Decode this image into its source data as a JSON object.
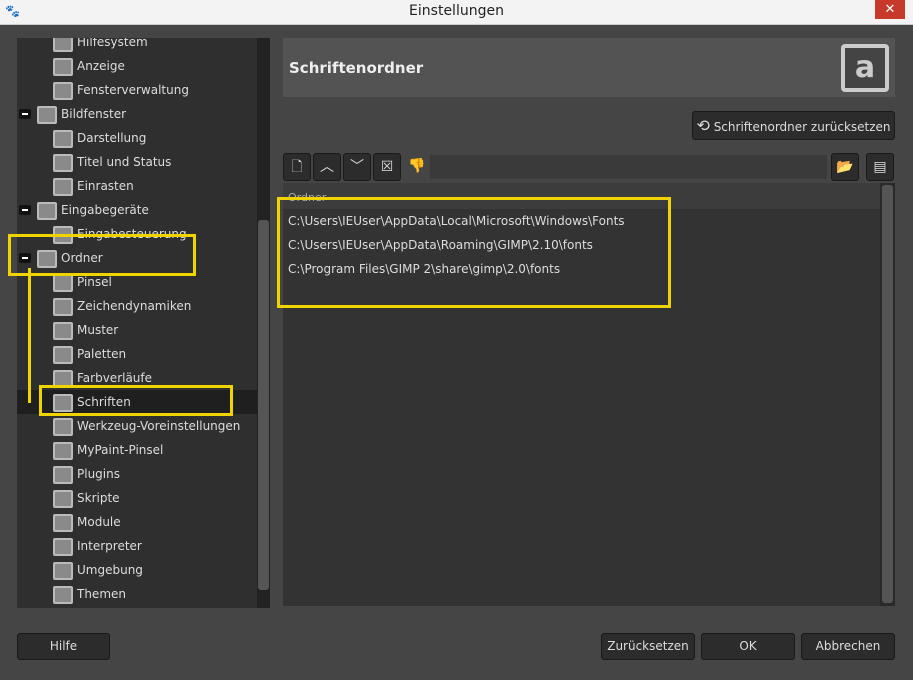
{
  "window": {
    "title": "Einstellungen",
    "close": "✕"
  },
  "tree": [
    {
      "label": "Hilfesystem",
      "level": 1
    },
    {
      "label": "Anzeige",
      "level": 1
    },
    {
      "label": "Fensterverwaltung",
      "level": 1
    },
    {
      "label": "Bildfenster",
      "level": 0
    },
    {
      "label": "Darstellung",
      "level": 1
    },
    {
      "label": "Titel und Status",
      "level": 1
    },
    {
      "label": "Einrasten",
      "level": 1
    },
    {
      "label": "Eingabegeräte",
      "level": 0
    },
    {
      "label": "Eingabesteuerung",
      "level": 1
    },
    {
      "label": "Ordner",
      "level": 0
    },
    {
      "label": "Pinsel",
      "level": 1
    },
    {
      "label": "Zeichendynamiken",
      "level": 1
    },
    {
      "label": "Muster",
      "level": 1
    },
    {
      "label": "Paletten",
      "level": 1
    },
    {
      "label": "Farbverläufe",
      "level": 1
    },
    {
      "label": "Schriften",
      "level": 1,
      "selected": true
    },
    {
      "label": "Werkzeug-Voreinstellungen",
      "level": 1
    },
    {
      "label": "MyPaint-Pinsel",
      "level": 1
    },
    {
      "label": "Plugins",
      "level": 1
    },
    {
      "label": "Skripte",
      "level": 1
    },
    {
      "label": "Module",
      "level": 1
    },
    {
      "label": "Interpreter",
      "level": 1
    },
    {
      "label": "Umgebung",
      "level": 1
    },
    {
      "label": "Themen",
      "level": 1
    }
  ],
  "panel": {
    "title": "Schriftenordner",
    "reset_button": "Schriftenordner zurücksetzen",
    "column_header": "Ordner",
    "folders": [
      "C:\\Users\\IEUser\\AppData\\Local\\Microsoft\\Windows\\Fonts",
      "C:\\Users\\IEUser\\AppData\\Roaming\\GIMP\\2.10\\fonts",
      "C:\\Program Files\\GIMP 2\\share\\gimp\\2.0\\fonts"
    ]
  },
  "footer": {
    "help": "Hilfe",
    "reset": "Zurücksetzen",
    "ok": "OK",
    "cancel": "Abbrechen"
  }
}
